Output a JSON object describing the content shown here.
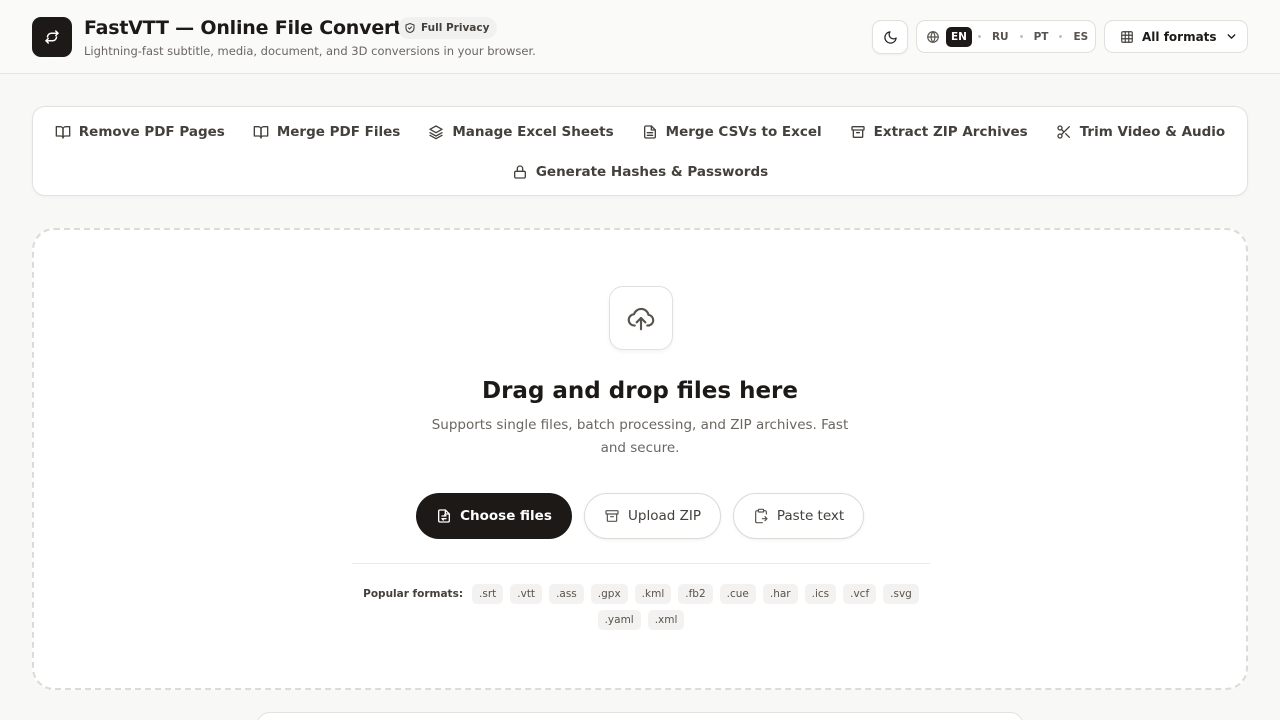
{
  "header": {
    "title": "FastVTT — Online File Converter",
    "privacy_badge": "Full Privacy",
    "subtitle": "Lightning-fast subtitle, media, document, and 3D conversions in your browser.",
    "languages": [
      {
        "code": "EN",
        "active": true
      },
      {
        "code": "RU",
        "active": false
      },
      {
        "code": "PT",
        "active": false
      },
      {
        "code": "ES",
        "active": false
      }
    ],
    "formats_button": "All formats"
  },
  "tools": [
    {
      "label": "Remove PDF Pages",
      "icon": "book-open-icon"
    },
    {
      "label": "Merge PDF Files",
      "icon": "book-open-icon"
    },
    {
      "label": "Manage Excel Sheets",
      "icon": "layers-icon"
    },
    {
      "label": "Merge CSVs to Excel",
      "icon": "file-text-icon"
    },
    {
      "label": "Extract ZIP Archives",
      "icon": "archive-icon"
    },
    {
      "label": "Trim Video & Audio",
      "icon": "scissors-icon"
    },
    {
      "label": "Generate Hashes & Passwords",
      "icon": "lock-icon"
    }
  ],
  "dropzone": {
    "title": "Drag and drop files here",
    "description": "Supports single files, batch processing, and ZIP archives. Fast and secure.",
    "choose_files": "Choose files",
    "upload_zip": "Upload ZIP",
    "paste_text": "Paste text",
    "popular_label": "Popular formats:",
    "formats": [
      ".srt",
      ".vtt",
      ".ass",
      ".gpx",
      ".kml",
      ".fb2",
      ".cue",
      ".har",
      ".ics",
      ".vcf",
      ".svg",
      ".yaml",
      ".xml"
    ]
  },
  "colors": {
    "primary": "#1c1917",
    "background": "#f8f8f7",
    "muted_text": "#6b6660"
  }
}
